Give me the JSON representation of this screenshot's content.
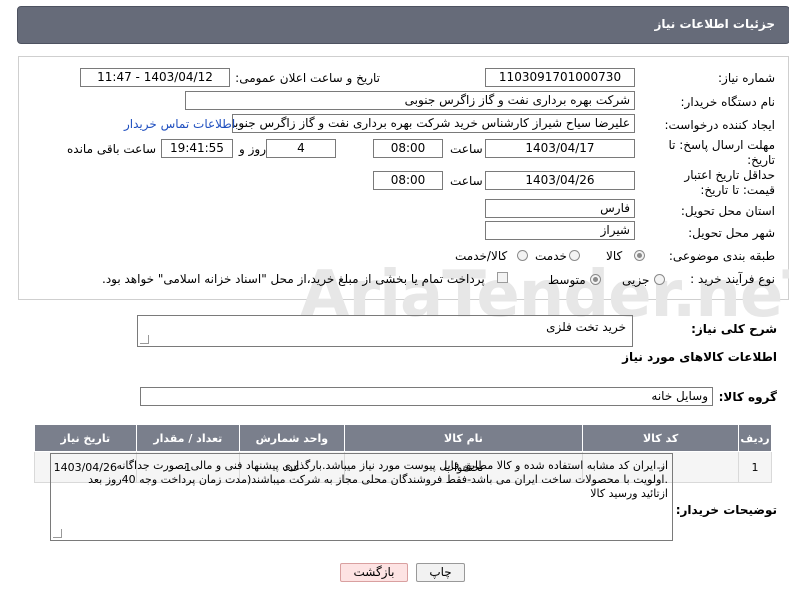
{
  "header": {
    "title": "جزئیات اطلاعات نیاز"
  },
  "form": {
    "need_number_label": "شماره نیاز:",
    "need_number": "1103091701000730",
    "announce_label": "تاریخ و ساعت اعلان عمومی:",
    "announce_value": "1403/04/12 - 11:47",
    "buyer_org_label": "نام دستگاه خریدار:",
    "buyer_org": "شرکت بهره برداری نفت و گاز زاگرس جنوبی",
    "creator_label": "ایجاد کننده درخواست:",
    "creator": "علیرضا سیاح شیراز کارشناس خرید شرکت بهره برداری نفت و گاز زاگرس جنوبی",
    "contact_link": "اطلاعات تماس خریدار",
    "deadline_label": "مهلت ارسال پاسخ: تا تاریخ:",
    "deadline_date": "1403/04/17",
    "time_label": "ساعت",
    "deadline_time": "08:00",
    "days_value": "4",
    "days_label": "روز و",
    "remaining_time": "19:41:55",
    "remaining_label": "ساعت باقی مانده",
    "price_validity_label": "حداقل تاریخ اعتبار قیمت: تا تاریخ:",
    "price_validity_date": "1403/04/26",
    "price_validity_time": "08:00",
    "province_label": "استان محل تحویل:",
    "province": "فارس",
    "city_label": "شهر محل تحویل:",
    "city": "شیراز",
    "category_label": "طبقه بندی موضوعی:",
    "category_options": [
      "کالا",
      "خدمت",
      "کالا/خدمت"
    ],
    "purchase_type_label": "نوع فرآیند خرید :",
    "purchase_options": [
      "جزیی",
      "متوسط"
    ],
    "payment_note": "پرداخت تمام یا بخشی از مبلغ خرید،از محل \"اسناد خزانه اسلامی\" خواهد بود."
  },
  "summary": {
    "label": "شرح کلی نیاز:",
    "value": "خرید تخت فلزی"
  },
  "goods_info_title": "اطلاعات کالاهای مورد نیاز",
  "goods_group": {
    "label": "گروه کالا:",
    "value": "وسایل خانه"
  },
  "table": {
    "headers": [
      "ردیف",
      "کد کالا",
      "نام کالا",
      "واحد شمارش",
      "تعداد / مقدار",
      "تاریخ نیاز"
    ],
    "rows": [
      [
        "1",
        "--",
        "تختخواب",
        "عدد",
        "1",
        "1403/04/26"
      ]
    ]
  },
  "buyer_notes": {
    "label": "توضیحات خریدار:",
    "line1": "از ایران کد مشابه استفاده شده و کالا مطابق فایل پیوست مورد نیاز میباشد.بارگذاری پیشنهاد فنی و مالی بصورت جداگانه",
    "line2": ".اولویت با محصولات ساخت ایران می باشد-فقط فروشندگان محلی مجاز به شرکت میباشند(مدت زمان پرداخت وجه 40روز بعد",
    "line3": "ازتائید ورسید کالا"
  },
  "buttons": {
    "print": "چاپ",
    "back": "بازگشت"
  },
  "watermark": "AriaTender.neT"
}
